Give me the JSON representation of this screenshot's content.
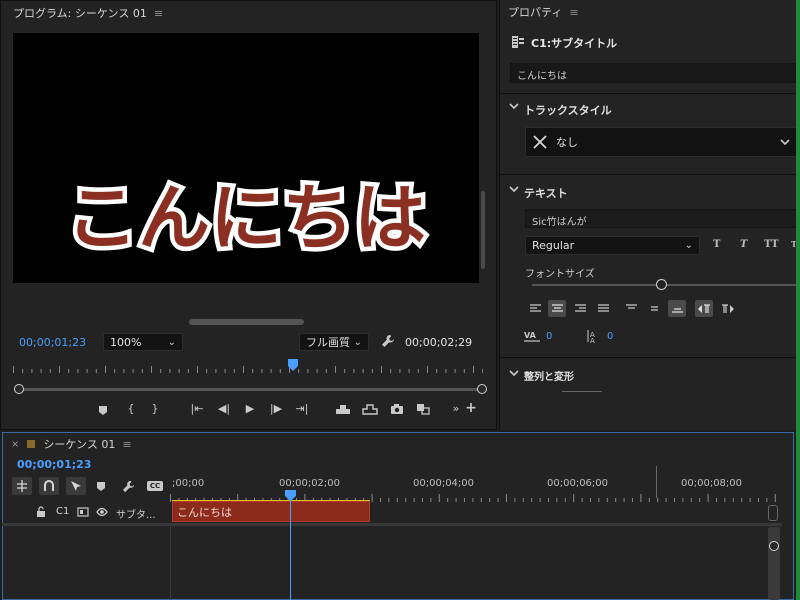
{
  "program_monitor": {
    "title": "プログラム: シーケンス 01",
    "menu_icon": "hamburger-menu-icon",
    "video_text": "こんにちは",
    "current_timecode": "00;00;01;23",
    "zoom_level": "100%",
    "resolution": "フル画質",
    "duration_timecode": "00;00;02;29",
    "playhead_fraction": 0.6,
    "controls": [
      "marker-icon",
      "mark-in-icon",
      "mark-out-icon",
      "go-to-in-icon",
      "step-back-icon",
      "play-icon",
      "step-forward-icon",
      "go-to-out-icon",
      "lift-icon",
      "extract-icon",
      "export-frame-icon",
      "compare-icon",
      "more-icon",
      "add-button-icon"
    ]
  },
  "properties": {
    "title": "プロパティ",
    "caption_label": "C1:サブタイトル",
    "caption_text": "こんにちは",
    "track_style": {
      "heading": "トラックスタイル",
      "value": "なし"
    },
    "text_section": {
      "heading": "テキスト",
      "font_family": "Sic竹はんが",
      "font_style": "Regular",
      "style_buttons": [
        "T",
        "T",
        "TT",
        "T"
      ],
      "font_size_label": "フォントサイズ",
      "tracking_value": "0",
      "leading_value": "0"
    },
    "align_section": {
      "heading": "整列と変形"
    }
  },
  "sequence": {
    "title": "シーケンス 01",
    "current_timecode": "00;00;01;23",
    "ruler_labels": [
      ";00;00",
      "00;00;02;00",
      "00;00;04;00",
      "00;00;06;00",
      "00;00;08;00"
    ],
    "track": {
      "lock_icon": "lock-icon",
      "name": "C1",
      "label": "サブタ...",
      "clip_text": "こんにちは"
    }
  },
  "colors": {
    "accent_blue": "#4a9eff",
    "clip_red": "#8c2a1c",
    "panel_bg": "#232323"
  }
}
